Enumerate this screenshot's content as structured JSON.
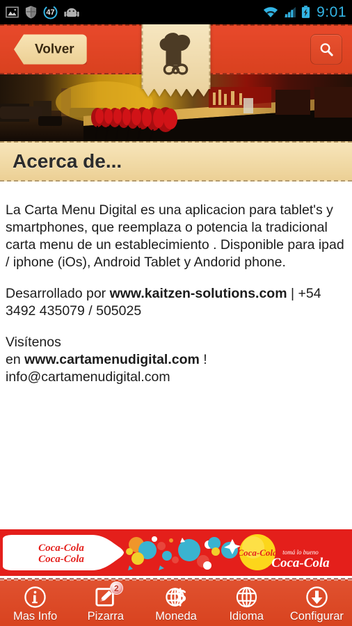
{
  "statusbar": {
    "icons": [
      "image-icon",
      "shield-icon",
      "counter-badge-icon",
      "android-icon",
      "wifi-icon",
      "signal-icon",
      "battery-charging-icon"
    ],
    "counter": "47",
    "time": "9:01",
    "time_color": "#33b5e5",
    "background": "#000000"
  },
  "header": {
    "back_label": "Volver",
    "search_icon": "search-icon",
    "logo_icon": "chef-hat-mustache-logo",
    "background": "#dd4424",
    "banner_color": "#f0dcae"
  },
  "hero": {
    "alt": "restaurant-bar-photo"
  },
  "section": {
    "title": "Acerca de..."
  },
  "content": {
    "paragraph1": "La Carta Menu Digital es una aplicacion para tablet's y smartphones, que reemplaza o potencia la tradicional carta menu de un establecimiento . Disponible para ipad / iphone (iOs), Android Tablet y Andorid phone.",
    "paragraph2_pre": "Desarrollado por ",
    "paragraph2_link": "www.kaitzen-solutions.com",
    "paragraph2_post": " | +54 3492 435079 / 505025",
    "paragraph3_line1": "Visítenos",
    "paragraph3_pre": "en ",
    "paragraph3_link": "www.cartamenudigital.com",
    "paragraph3_post": " ! info@cartamenudigital.com"
  },
  "ad": {
    "name": "coca-cola-ad-banner",
    "brand": "Coca-Cola",
    "tagline": "tomá lo bueno",
    "background": "#e41f1b"
  },
  "navbar": {
    "background": "#dd4723",
    "items": [
      {
        "label": "Mas Info",
        "icon": "info-circle-icon",
        "badge": ""
      },
      {
        "label": "Pizarra",
        "icon": "edit-square-icon",
        "badge": "2"
      },
      {
        "label": "Moneda",
        "icon": "globe-dollar-icon",
        "badge": ""
      },
      {
        "label": "Idioma",
        "icon": "globe-icon",
        "badge": ""
      },
      {
        "label": "Configurar",
        "icon": "download-circle-icon",
        "badge": ""
      }
    ]
  }
}
